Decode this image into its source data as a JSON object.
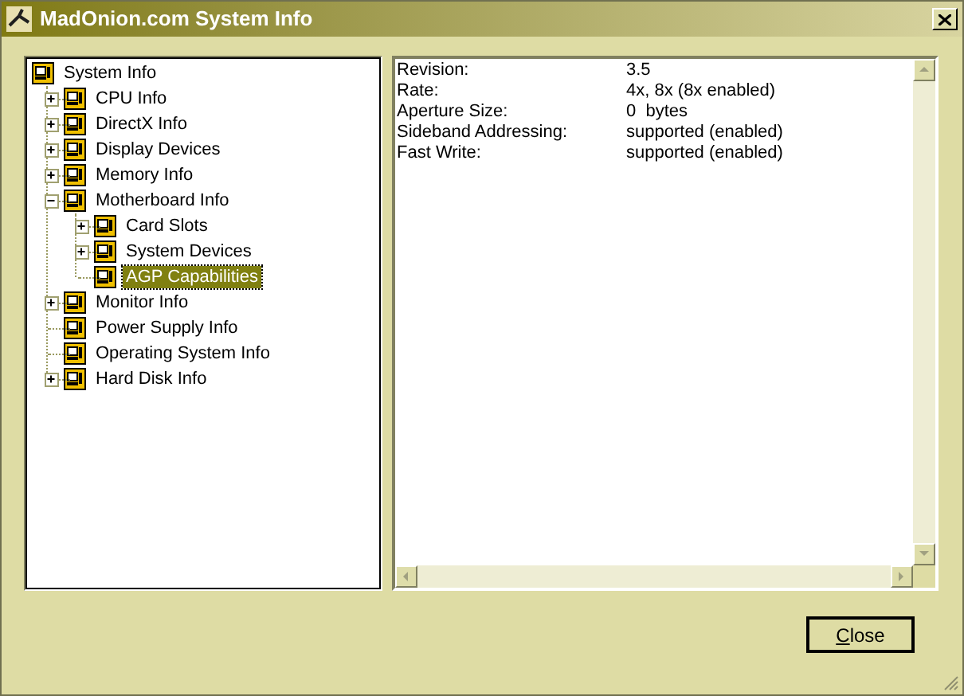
{
  "window": {
    "title": "MadOnion.com System Info"
  },
  "tree": [
    {
      "label": "System Info",
      "selected": false,
      "children": [
        {
          "toggle": "+",
          "label": "CPU Info",
          "selected": false
        },
        {
          "toggle": "+",
          "label": "DirectX Info",
          "selected": false
        },
        {
          "toggle": "+",
          "label": "Display Devices",
          "selected": false
        },
        {
          "toggle": "+",
          "label": "Memory Info",
          "selected": false
        },
        {
          "toggle": "−",
          "label": "Motherboard Info",
          "selected": false,
          "children": [
            {
              "toggle": "+",
              "label": "Card Slots",
              "selected": false
            },
            {
              "toggle": "+",
              "label": "System Devices",
              "selected": false
            },
            {
              "label": "AGP Capabilities",
              "selected": true
            }
          ]
        },
        {
          "toggle": "+",
          "label": "Monitor Info",
          "selected": false
        },
        {
          "label": "Power Supply Info",
          "selected": false
        },
        {
          "label": "Operating System Info",
          "selected": false
        },
        {
          "toggle": "+",
          "label": "Hard Disk Info",
          "selected": false
        }
      ]
    }
  ],
  "details": [
    {
      "name": "Revision:",
      "value": "3.5"
    },
    {
      "name": "Rate:",
      "value": "4x, 8x (8x enabled)"
    },
    {
      "name": "Aperture Size:",
      "value": "0  bytes"
    },
    {
      "name": "Sideband Addressing:",
      "value": "supported (enabled)"
    },
    {
      "name": "Fast Write:",
      "value": "supported (enabled)"
    }
  ],
  "buttons": [
    {
      "label": "Close"
    }
  ]
}
